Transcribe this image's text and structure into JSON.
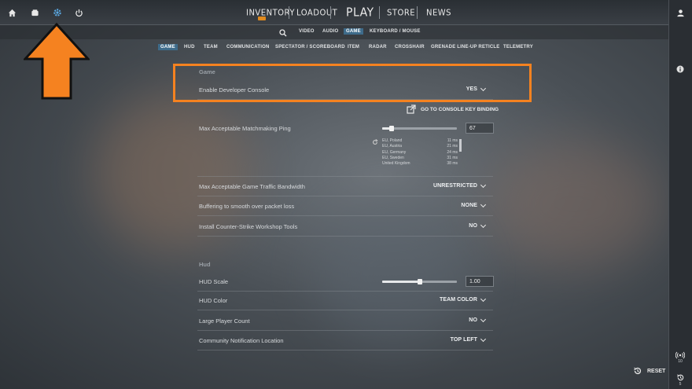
{
  "top_nav": {
    "inventory": "INVENTORY",
    "loadout": "LOADOUT",
    "play": "PLAY",
    "store": "STORE",
    "news": "NEWS"
  },
  "settings_nav": [
    "VIDEO",
    "AUDIO",
    "GAME",
    "KEYBOARD / MOUSE"
  ],
  "settings_nav_active": "GAME",
  "game_tabs": [
    "GAME",
    "HUD",
    "TEAM",
    "COMMUNICATION",
    "SPECTATOR / SCOREBOARD",
    "ITEM",
    "RADAR",
    "CROSSHAIR",
    "GRENADE LINE-UP RETICLE",
    "TELEMETRY"
  ],
  "game_tabs_active": "GAME",
  "game_section": {
    "title": "Game",
    "dev_console": {
      "label": "Enable Developer Console",
      "value": "YES"
    },
    "console_link": "GO TO CONSOLE KEY BINDING",
    "mm_ping": {
      "label": "Max Acceptable Matchmaking Ping",
      "value": "67",
      "slider_fraction": 0.13
    },
    "ping_servers": [
      {
        "name": "EU, Poland",
        "ping": "11 ms"
      },
      {
        "name": "EU, Austria",
        "ping": "21 ms"
      },
      {
        "name": "EU, Germany",
        "ping": "24 ms"
      },
      {
        "name": "EU, Sweden",
        "ping": "31 ms"
      },
      {
        "name": "United Kingdom",
        "ping": "38 ms"
      }
    ],
    "bandwidth": {
      "label": "Max Acceptable Game Traffic Bandwidth",
      "value": "UNRESTRICTED"
    },
    "buffering": {
      "label": "Buffering to smooth over packet loss",
      "value": "NONE"
    },
    "workshop": {
      "label": "Install Counter-Strike Workshop Tools",
      "value": "NO"
    }
  },
  "hud_section": {
    "title": "Hud",
    "hud_scale": {
      "label": "HUD Scale",
      "value": "1.00",
      "slider_fraction": 0.5
    },
    "hud_color": {
      "label": "HUD Color",
      "value": "TEAM COLOR"
    },
    "large_player": {
      "label": "Large Player Count",
      "value": "NO"
    },
    "notif_location": {
      "label": "Community Notification Location",
      "value": "TOP LEFT"
    }
  },
  "reset_label": "RESET",
  "rail_counts": {
    "players": "10",
    "history": "5"
  },
  "colors": {
    "highlight": "#f58220",
    "active_tab": "#3e6b8a",
    "arrow": "#f58220"
  }
}
